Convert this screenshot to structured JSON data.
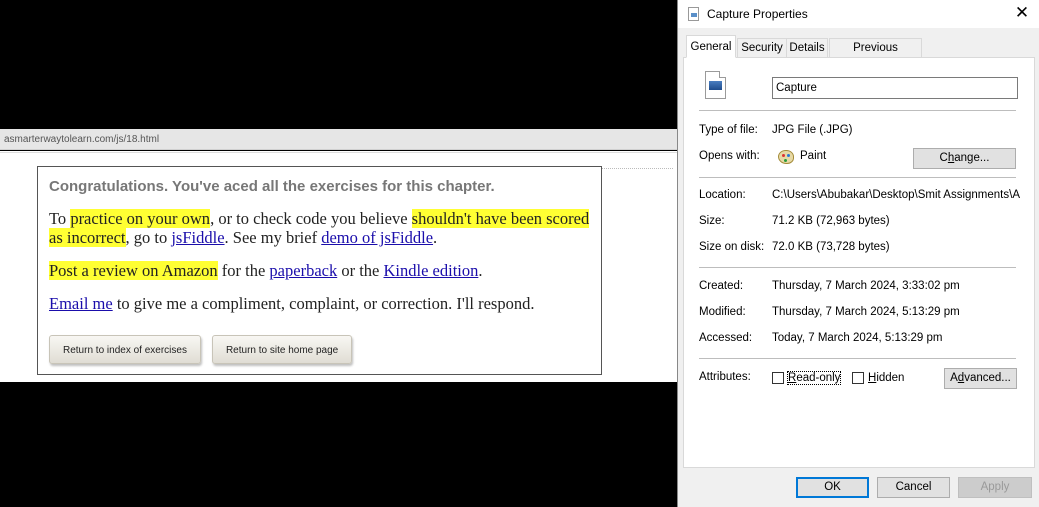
{
  "capture": {
    "url": "asmarterwaytolearn.com/js/18.html",
    "heading": "Congratulations. You've aced all the exercises for this chapter.",
    "p1": {
      "t1": "To ",
      "h1": "practice on your own",
      "t2": ", or to check code you believe ",
      "h2": "shouldn't have been scored as incorrect",
      "t3": ", go to ",
      "l1": "jsFiddle",
      "t4": ". See my brief ",
      "l2": "demo of jsFiddle",
      "t5": "."
    },
    "p2": {
      "h1": "Post a review on Amazon",
      "t1": " for the ",
      "l1": "paperback",
      "t2": " or the ",
      "l2": "Kindle edition",
      "t3": "."
    },
    "p3": {
      "l1": "Email me",
      "t1": " to give me a compliment, complaint, or correction. I'll respond."
    },
    "buttons": {
      "index": "Return to index of exercises",
      "home": "Return to site home page"
    }
  },
  "dialog": {
    "title": "Capture Properties",
    "close_glyph": "✕",
    "tabs": [
      "General",
      "Security",
      "Details",
      "Previous Versions"
    ],
    "file_name": "Capture",
    "type_of_file": {
      "label": "Type of file:",
      "value": "JPG File (.JPG)"
    },
    "opens_with": {
      "label": "Opens with:",
      "value": "Paint",
      "button_pre": "C",
      "button_ul": "h",
      "button_post": "ange..."
    },
    "location": {
      "label": "Location:",
      "value": "C:\\Users\\Abubakar\\Desktop\\Smit Assignments\\Ass"
    },
    "size": {
      "label": "Size:",
      "value": "71.2 KB (72,963 bytes)"
    },
    "size_on_disk": {
      "label": "Size on disk:",
      "value": "72.0 KB (73,728 bytes)"
    },
    "created": {
      "label": "Created:",
      "value": "Thursday, 7 March 2024, 3:33:02 pm"
    },
    "modified": {
      "label": "Modified:",
      "value": "Thursday, 7 March 2024, 5:13:29 pm"
    },
    "accessed": {
      "label": "Accessed:",
      "value": "Today, 7 March 2024, 5:13:29 pm"
    },
    "attributes": {
      "label": "Attributes:",
      "readonly_ul": "R",
      "readonly_rest": "ead-only",
      "readonly_checked": false,
      "hidden_pre": "H",
      "hidden_rest": "idden",
      "hidden_checked": false,
      "advanced_pre": "A",
      "advanced_ul": "d",
      "advanced_post": "vanced..."
    },
    "footer": {
      "ok": "OK",
      "cancel": "Cancel",
      "apply": "Apply"
    },
    "colors": {
      "focus": "#0078d7",
      "link": "#1a0dab",
      "highlight": "#ffff33"
    }
  }
}
